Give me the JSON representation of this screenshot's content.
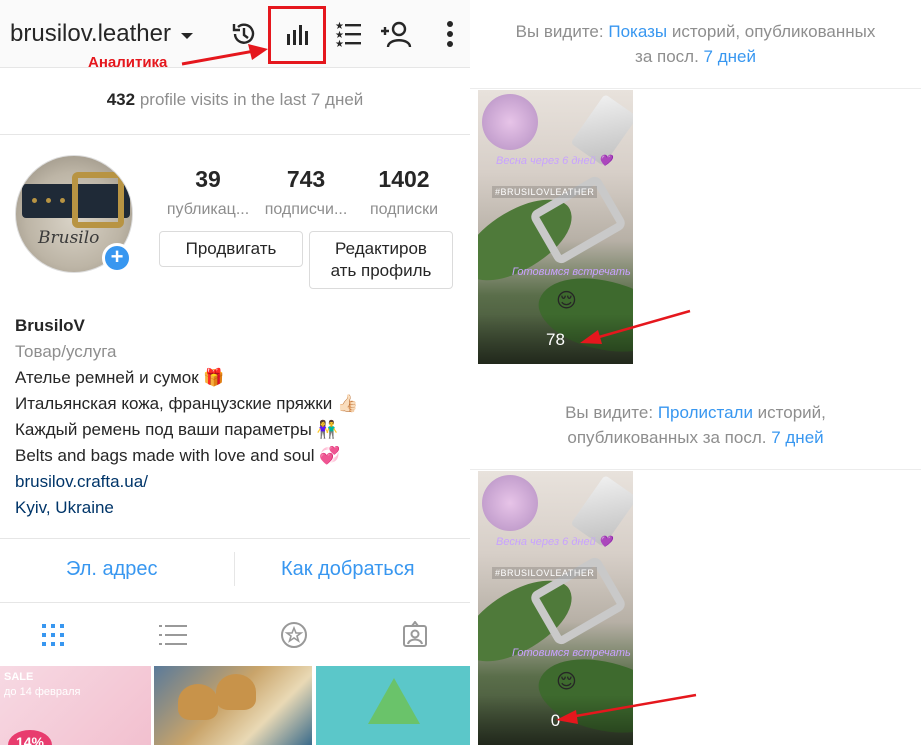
{
  "profile": {
    "username": "brusilov.leather",
    "annotation_label": "Аналитика",
    "visits_count": "432",
    "visits_text": "profile visits in the last 7 дней",
    "stats": [
      {
        "num": "39",
        "label": "публикац..."
      },
      {
        "num": "743",
        "label": "подписчи..."
      },
      {
        "num": "1402",
        "label": "подписки"
      }
    ],
    "promote_button": "Продвигать",
    "edit_button_line1": "Редактиров",
    "edit_button_line2": "ать профиль",
    "avatar_script": "Brusilo"
  },
  "bio": {
    "name": "BrusiloV",
    "category": "Товар/услуга",
    "line1": "Ателье ремней и сумок 🎁",
    "line2": "Итальянская кожа, французские пряжки 👍🏻",
    "line3": "Каждый ремень под ваши параметры 👫",
    "line4": "Belts and bags made with love and soul 💞",
    "link": "brusilov.crafta.ua/",
    "location_city": "Kyiv",
    "location_country": ", Ukraine"
  },
  "contact": {
    "email": "Эл. адрес",
    "directions": "Как добраться"
  },
  "thumbnails": {
    "t1_sale": "SALE",
    "t1_date": "до 14 февраля",
    "t1_pct": "14%"
  },
  "stories": {
    "caption1_pre": "Вы видите: ",
    "caption1_hl": "Показы",
    "caption1_mid": " историй, опубликованных",
    "caption1_line2_pre": "за посл. ",
    "caption1_line2_hl": "7 дней",
    "caption2_pre": "Вы видите: ",
    "caption2_hl": "Пролистали",
    "caption2_mid": " историй,",
    "caption2_line2_pre": "опубликованных за посл. ",
    "caption2_line2_hl": "7 дней",
    "story_text_top": "Весна через 6 дней 💜",
    "story_hashtag": "#BRUSILOVLEATHER",
    "story_text_bottom": "Готовимся встречать",
    "story1_count": "78",
    "story2_count": "0"
  },
  "colors": {
    "accent_blue": "#3897f0",
    "annotation_red": "#e5171d"
  }
}
